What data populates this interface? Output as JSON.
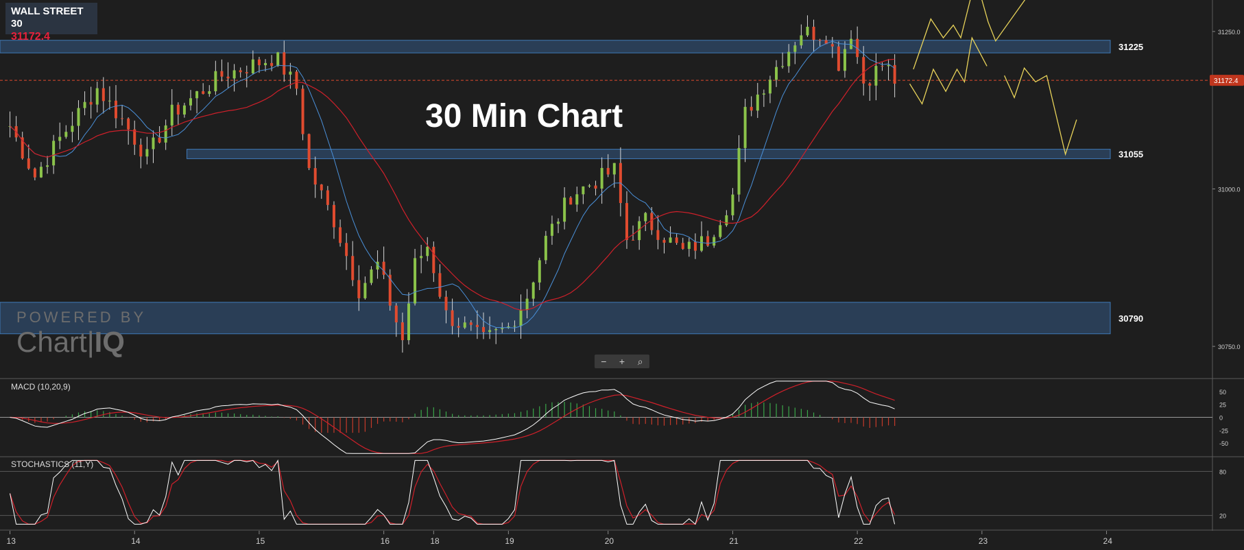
{
  "header": {
    "symbol": "WALL STREET 30",
    "price": "31172.4"
  },
  "overlay_title": "30 Min Chart",
  "logo": {
    "line1": "POWERED BY",
    "line2a": "Chart",
    "line2b": "IQ"
  },
  "zoom": {
    "minus": "−",
    "plus": "+",
    "reset": "⌕"
  },
  "colors": {
    "up": "#8bc34a",
    "down": "#e04b2f",
    "ma_fast": "#4a90d9",
    "ma_slow": "#d0202a",
    "zone": "#2f4a6a",
    "zone_border": "#3f7ab8",
    "forecast": "#e8d35a",
    "price_badge": "#c0361e"
  },
  "chart_data": [
    {
      "type": "candlestick",
      "title": "30 Min Chart",
      "ylim": [
        30700,
        31300
      ],
      "y_ticks": [
        {
          "value": 31250,
          "label": "31250.0"
        },
        {
          "value": 31000,
          "label": "31000.0"
        },
        {
          "value": 30750,
          "label": "30750.0"
        }
      ],
      "x_ticks": [
        {
          "label": "13",
          "x": 0
        },
        {
          "label": "14",
          "x": 10
        },
        {
          "label": "15",
          "x": 20
        },
        {
          "label": "16",
          "x": 30
        },
        {
          "label": "18",
          "x": 34
        },
        {
          "label": "19",
          "x": 40
        },
        {
          "label": "20",
          "x": 48
        },
        {
          "label": "21",
          "x": 58
        },
        {
          "label": "22",
          "x": 68
        },
        {
          "label": "23",
          "x": 78
        },
        {
          "label": "24",
          "x": 88
        }
      ],
      "xlim": [
        -0.8,
        96.5
      ],
      "current_price": {
        "value": 31172.4,
        "label": "31172.4"
      },
      "zones": [
        {
          "low": 31216,
          "high": 31236,
          "x_start": -0.8,
          "x_end": 88.3,
          "label": "31225"
        },
        {
          "low": 31048,
          "high": 31063,
          "x_start": 14.2,
          "x_end": 88.3,
          "label": "31055"
        },
        {
          "low": 30770,
          "high": 30820,
          "x_start": -0.8,
          "x_end": 88.3,
          "label": "30790"
        }
      ],
      "key_points": [
        {
          "x": 0,
          "y": 31100
        },
        {
          "x": 2,
          "y": 31020
        },
        {
          "x": 4,
          "y": 31080
        },
        {
          "x": 7,
          "y": 31160
        },
        {
          "x": 9,
          "y": 31110
        },
        {
          "x": 11,
          "y": 31050
        },
        {
          "x": 13,
          "y": 31120
        },
        {
          "x": 17,
          "y": 31180
        },
        {
          "x": 21.3,
          "y": 31210
        },
        {
          "x": 23,
          "y": 31160
        },
        {
          "x": 24,
          "y": 31030
        },
        {
          "x": 26,
          "y": 30950
        },
        {
          "x": 28,
          "y": 30840
        },
        {
          "x": 29.5,
          "y": 30880
        },
        {
          "x": 31.5,
          "y": 30760
        },
        {
          "x": 32.5,
          "y": 30880
        },
        {
          "x": 33.5,
          "y": 30910
        },
        {
          "x": 35,
          "y": 30800
        },
        {
          "x": 38,
          "y": 30760
        },
        {
          "x": 40,
          "y": 30780
        },
        {
          "x": 41.5,
          "y": 30830
        },
        {
          "x": 43,
          "y": 30920
        },
        {
          "x": 45,
          "y": 30990
        },
        {
          "x": 48.5,
          "y": 31030
        },
        {
          "x": 49.5,
          "y": 30920
        },
        {
          "x": 51,
          "y": 30950
        },
        {
          "x": 54,
          "y": 30900
        },
        {
          "x": 56,
          "y": 30920
        },
        {
          "x": 58,
          "y": 30990
        },
        {
          "x": 59,
          "y": 31120
        },
        {
          "x": 61,
          "y": 31180
        },
        {
          "x": 63.5,
          "y": 31250
        },
        {
          "x": 65.5,
          "y": 31245
        },
        {
          "x": 66.5,
          "y": 31200
        },
        {
          "x": 67.5,
          "y": 31250
        },
        {
          "x": 68.5,
          "y": 31170
        },
        {
          "x": 70.2,
          "y": 31200
        },
        {
          "x": 71,
          "y": 31172
        }
      ],
      "forecast_paths": [
        [
          {
            "x": 72.5,
            "y": 31190
          },
          {
            "x": 73.9,
            "y": 31270
          },
          {
            "x": 74.9,
            "y": 31240
          },
          {
            "x": 75.7,
            "y": 31260
          },
          {
            "x": 76.3,
            "y": 31240
          },
          {
            "x": 77.5,
            "y": 31335
          },
          {
            "x": 78.5,
            "y": 31265
          },
          {
            "x": 79.1,
            "y": 31235
          },
          {
            "x": 81.8,
            "y": 31310
          }
        ],
        [
          {
            "x": 72.2,
            "y": 31167
          },
          {
            "x": 73.2,
            "y": 31135
          },
          {
            "x": 74.1,
            "y": 31190
          },
          {
            "x": 75.1,
            "y": 31155
          },
          {
            "x": 76,
            "y": 31190
          },
          {
            "x": 76.6,
            "y": 31170
          },
          {
            "x": 77.2,
            "y": 31240
          },
          {
            "x": 78.4,
            "y": 31195
          }
        ],
        [
          {
            "x": 79.8,
            "y": 31180
          },
          {
            "x": 80.6,
            "y": 31145
          },
          {
            "x": 81.4,
            "y": 31192
          },
          {
            "x": 82.3,
            "y": 31170
          },
          {
            "x": 83.2,
            "y": 31180
          },
          {
            "x": 84.7,
            "y": 31055
          },
          {
            "x": 85.6,
            "y": 31110
          }
        ]
      ]
    },
    {
      "type": "line",
      "title": "MACD (10,20,9)",
      "ylim": [
        -75,
        75
      ],
      "y_ticks": [
        {
          "value": 50,
          "label": "50"
        },
        {
          "value": 25,
          "label": "25"
        },
        {
          "value": 0,
          "label": "0"
        },
        {
          "value": -25,
          "label": "-25"
        },
        {
          "value": -50,
          "label": "-50"
        }
      ]
    },
    {
      "type": "line",
      "title": "STOCHASTICS (11,Y)",
      "ylim": [
        0,
        100
      ],
      "y_ticks": [
        {
          "value": 80,
          "label": "80"
        },
        {
          "value": 20,
          "label": "20"
        }
      ]
    }
  ]
}
